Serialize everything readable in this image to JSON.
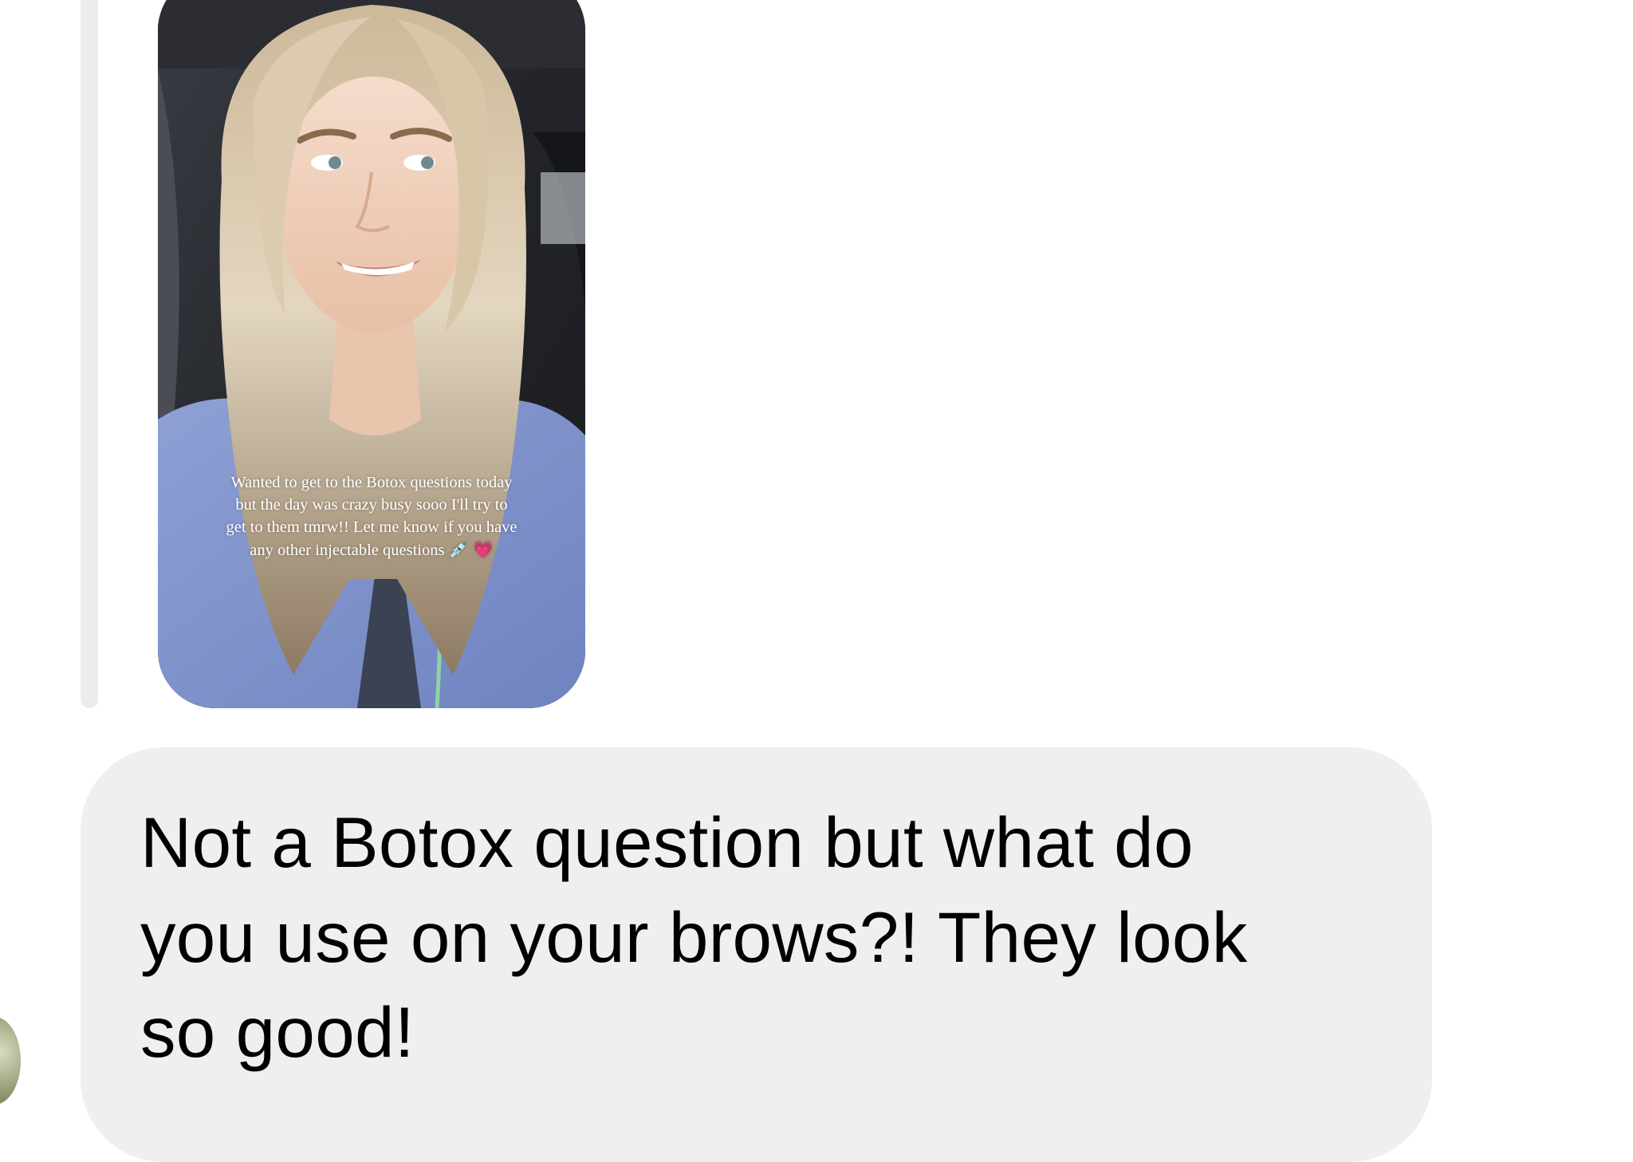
{
  "story_reply": {
    "caption_lines": [
      "Wanted to get to the Botox questions today",
      "but the day was crazy busy sooo I'll try to",
      "get to them tmrw!! Let me know if you have",
      "any other injectable questions"
    ],
    "caption_emoji": [
      "💉",
      "💗"
    ]
  },
  "message": {
    "text_lines": [
      "Not a Botox question but what do",
      "you use on your brows?! They look",
      "so good!"
    ]
  },
  "colors": {
    "bubble_bg": "#efefef",
    "reply_bar": "#ececec",
    "text": "#000000"
  }
}
